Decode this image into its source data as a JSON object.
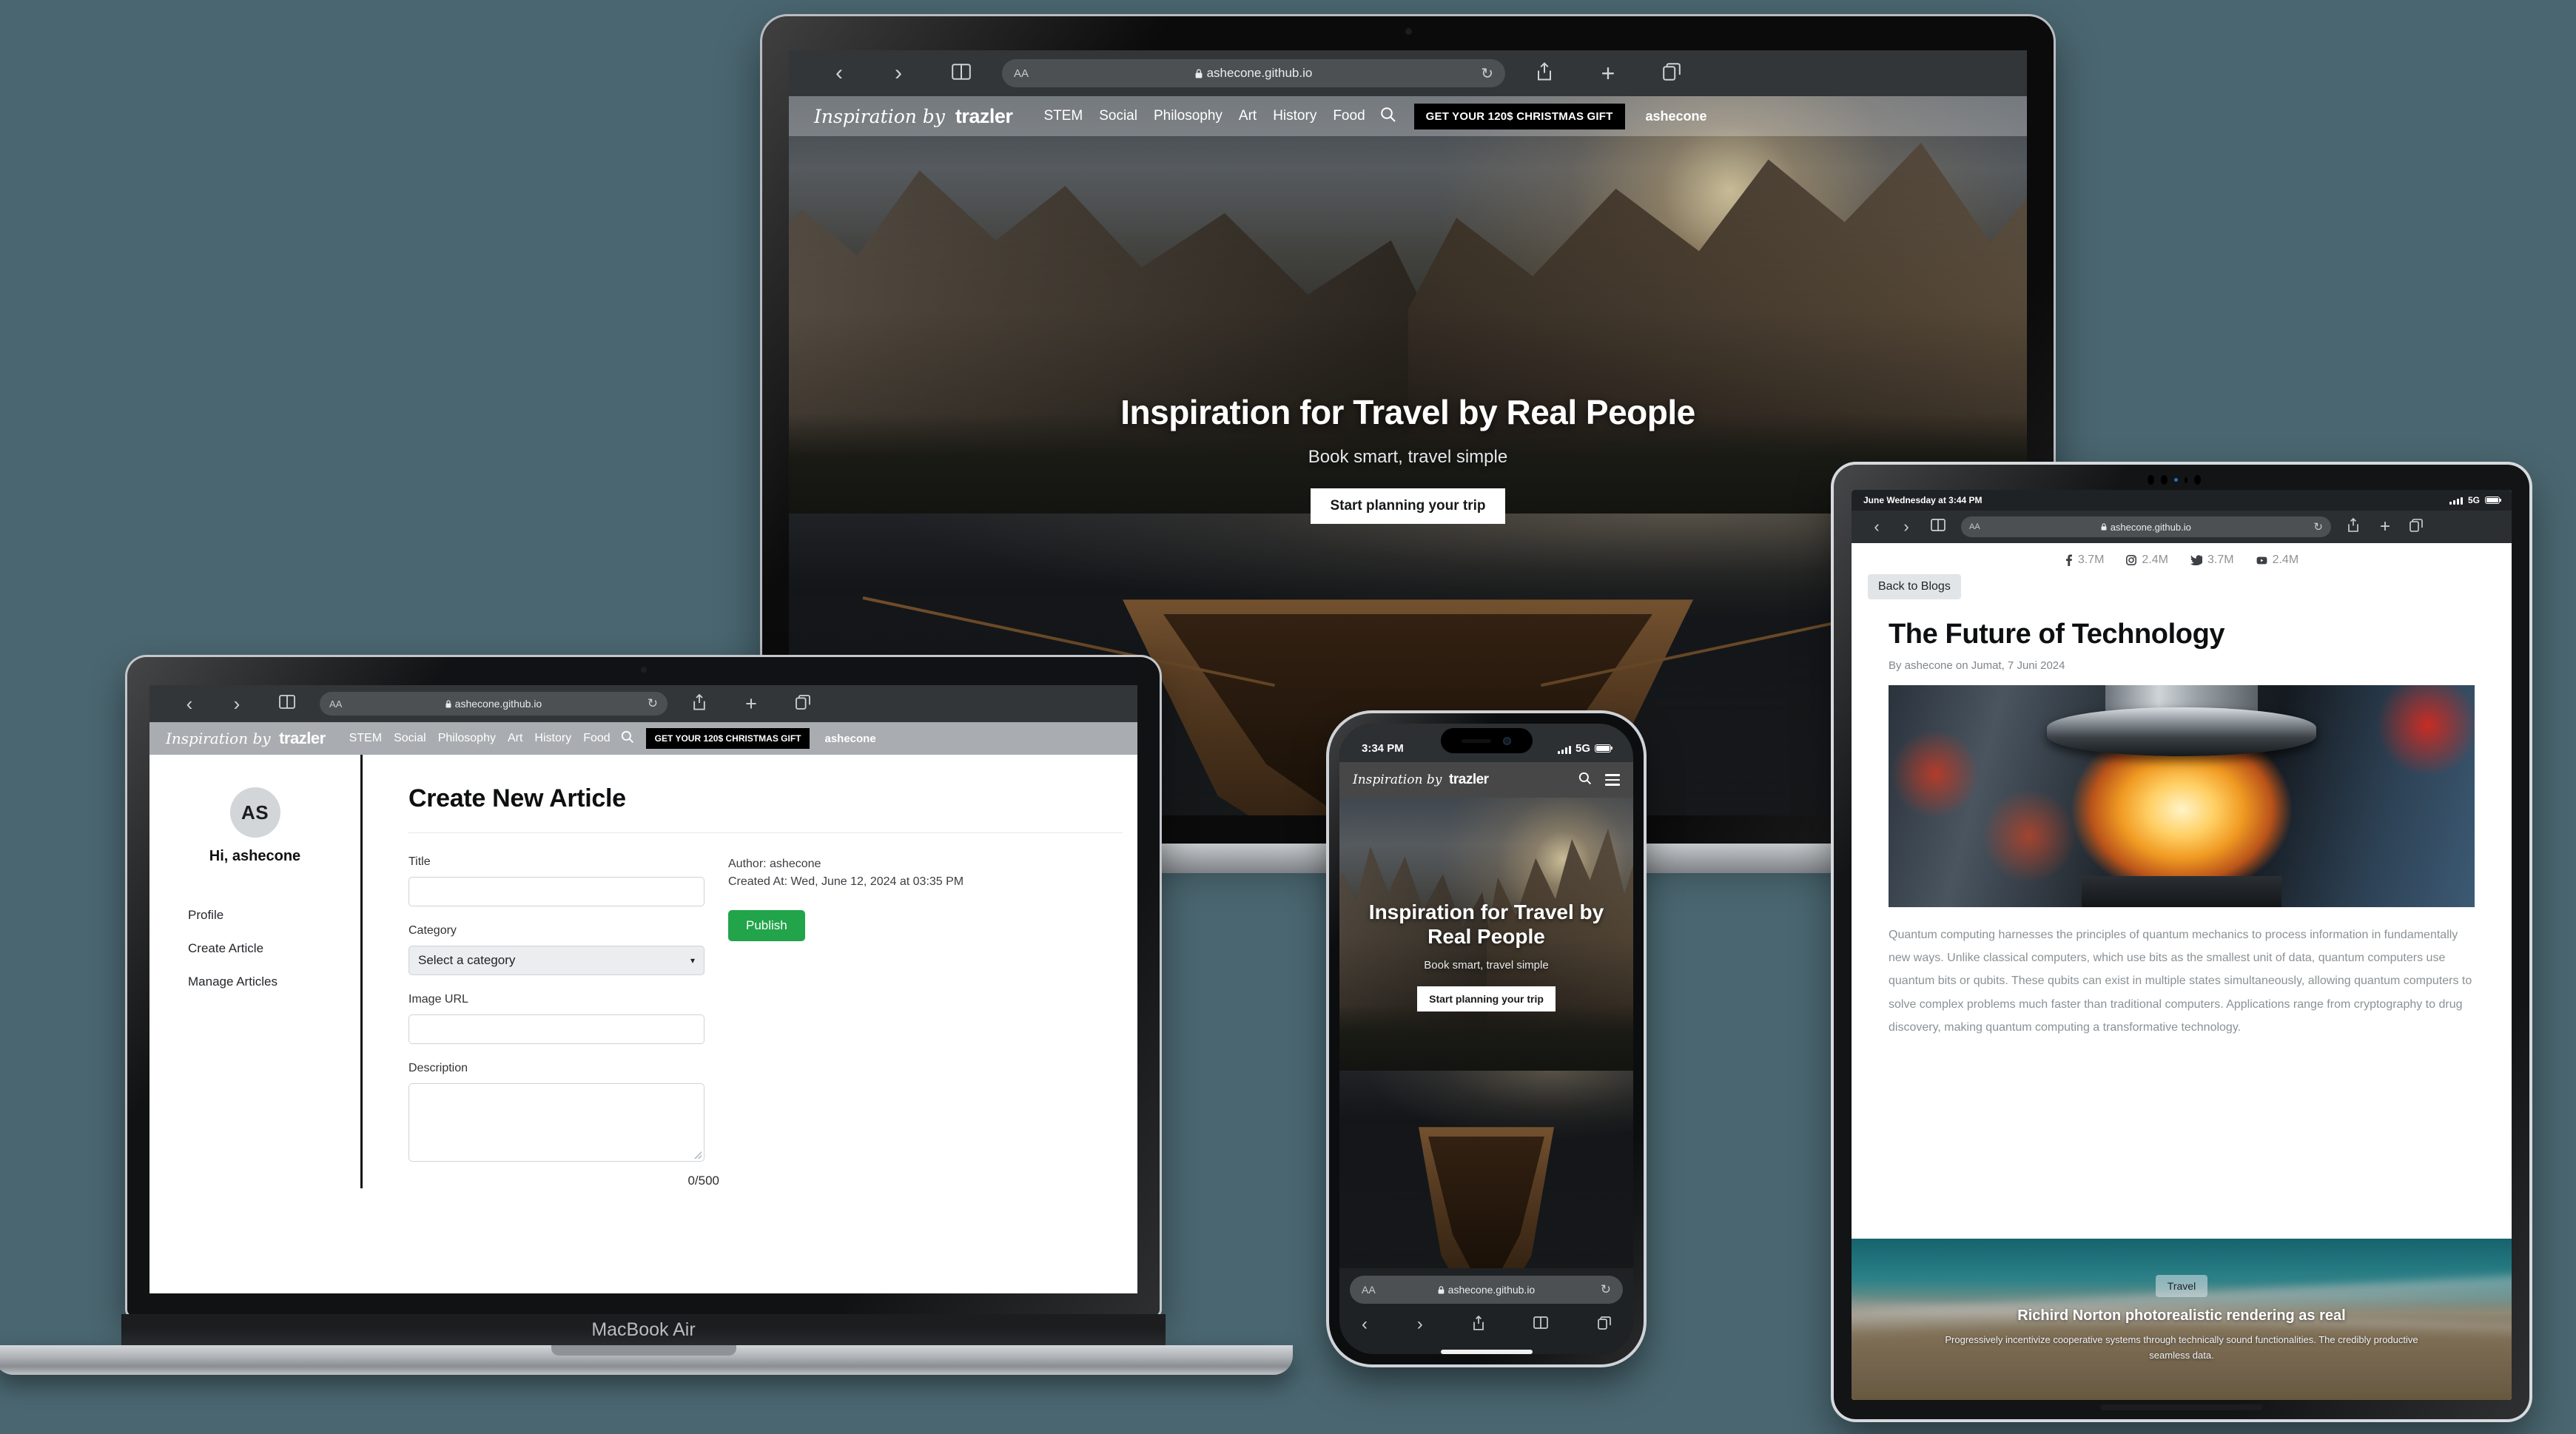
{
  "background_color": "#4a6670",
  "site": {
    "logo_script": "Inspiration by",
    "logo_brand": "trazler",
    "nav_links": [
      "STEM",
      "Social",
      "Philosophy",
      "Art",
      "History",
      "Food"
    ],
    "search_icon": "search-icon",
    "promo_label": "GET YOUR 120$ CHRISTMAS GIFT",
    "user": "ashecone",
    "hero": {
      "title": "Inspiration for Travel by Real People",
      "subtitle": "Book smart, travel simple",
      "cta": "Start planning your trip"
    }
  },
  "browser": {
    "url": "ashecone.github.io",
    "lock_icon": "lock-icon",
    "aa_label": "AA",
    "back_icon": "chevron-left-icon",
    "forward_icon": "chevron-right-icon",
    "sidebar_icon": "book-icon",
    "reload_icon": "reload-icon",
    "share_icon": "share-icon",
    "new_tab_icon": "plus-icon",
    "tabs_icon": "tabs-icon"
  },
  "macbook_pro": {
    "device_label": ""
  },
  "macbook_air": {
    "device_label": "MacBook Air",
    "sidebar": {
      "avatar_initials": "AS",
      "greeting": "Hi, ashecone",
      "links": [
        "Profile",
        "Create Article",
        "Manage Articles"
      ]
    },
    "form": {
      "heading": "Create New Article",
      "fields": [
        {
          "label": "Title",
          "type": "text",
          "value": ""
        },
        {
          "label": "Category",
          "type": "select",
          "value": "Select a category"
        },
        {
          "label": "Image URL",
          "type": "text",
          "value": ""
        },
        {
          "label": "Description",
          "type": "textarea",
          "value": ""
        }
      ],
      "author_line": "Author: ashecone",
      "created_line": "Created At: Wed, June 12, 2024 at 03:35 PM",
      "publish_label": "Publish",
      "publish_color": "#22a44b",
      "char_counter": "0/500"
    }
  },
  "ipad": {
    "status_bar": {
      "time": "June Wednesday at 3:44 PM",
      "network": "5G"
    },
    "social_stats": [
      {
        "icon": "facebook-icon",
        "value": "3.7M"
      },
      {
        "icon": "instagram-icon",
        "value": "2.4M"
      },
      {
        "icon": "twitter-icon",
        "value": "3.7M"
      },
      {
        "icon": "youtube-icon",
        "value": "2.4M"
      }
    ],
    "back_button": "Back to Blogs",
    "article": {
      "title": "The Future of Technology",
      "byline": "By ashecone on Jumat, 7 Juni 2024",
      "image_alt": "glowing-quantum-processor-photo",
      "body": "Quantum computing harnesses the principles of quantum mechanics to process information in fundamentally new ways. Unlike classical computers, which use bits as the smallest unit of data, quantum computers use quantum bits or qubits. These qubits can exist in multiple states simultaneously, allowing quantum computers to solve complex problems much faster than traditional computers. Applications range from cryptography to drug discovery, making quantum computing a transformative technology."
    },
    "related_card": {
      "tag": "Travel",
      "title": "Richird Norton photorealistic rendering as real",
      "excerpt": "Progressively incentivize cooperative systems through technically sound functionalities. The credibly productive seamless data."
    }
  },
  "iphone": {
    "status_bar": {
      "time": "3:34 PM",
      "network": "5G"
    },
    "nav": {
      "search_icon": "search-icon",
      "menu_icon": "hamburger-menu-icon"
    }
  }
}
